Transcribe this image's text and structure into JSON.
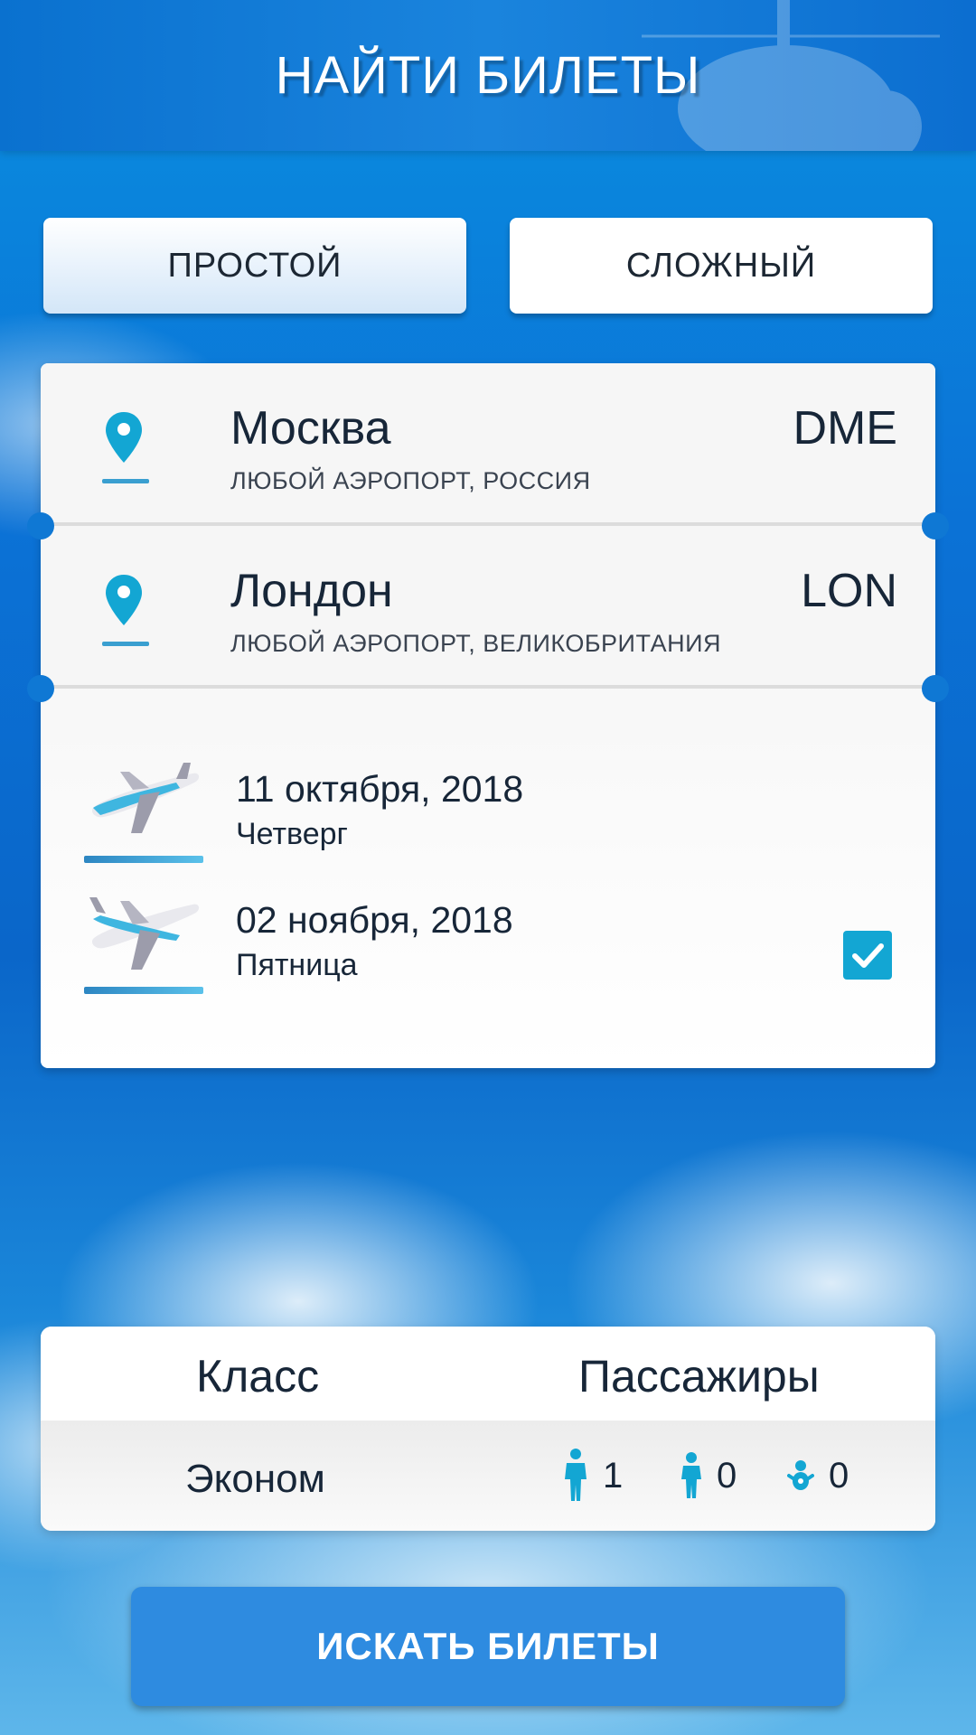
{
  "header": {
    "title": "НАЙТИ БИЛЕТЫ"
  },
  "mode_tabs": {
    "simple_label": "ПРОСТОЙ",
    "complex_label": "СЛОЖНЫЙ",
    "active": "simple"
  },
  "route": {
    "from": {
      "city": "Москва",
      "airport": "ЛЮБОЙ АЭРОПОРТ, РОССИЯ",
      "code": "DME",
      "icon": "location-pin-icon"
    },
    "to": {
      "city": "Лондон",
      "airport": "ЛЮБОЙ АЭРОПОРТ, ВЕЛИКОБРИТАНИЯ",
      "code": "LON",
      "icon": "location-pin-icon"
    }
  },
  "dates": {
    "departure": {
      "date": "11 октября, 2018",
      "weekday": "Четверг",
      "icon": "plane-departure-icon"
    },
    "return": {
      "date": "02 ноября, 2018",
      "weekday": "Пятница",
      "icon": "plane-return-icon",
      "checked": true
    }
  },
  "options": {
    "class_label": "Класс",
    "class_value": "Эконом",
    "passengers_label": "Пассажиры",
    "adults": "1",
    "children": "0",
    "infants": "0"
  },
  "search_button": {
    "label": "ИСКАТЬ БИЛЕТЫ"
  },
  "colors": {
    "accent": "#13a6d3",
    "button": "#2e8be0",
    "text": "#172638",
    "background": "#0b72d6"
  }
}
